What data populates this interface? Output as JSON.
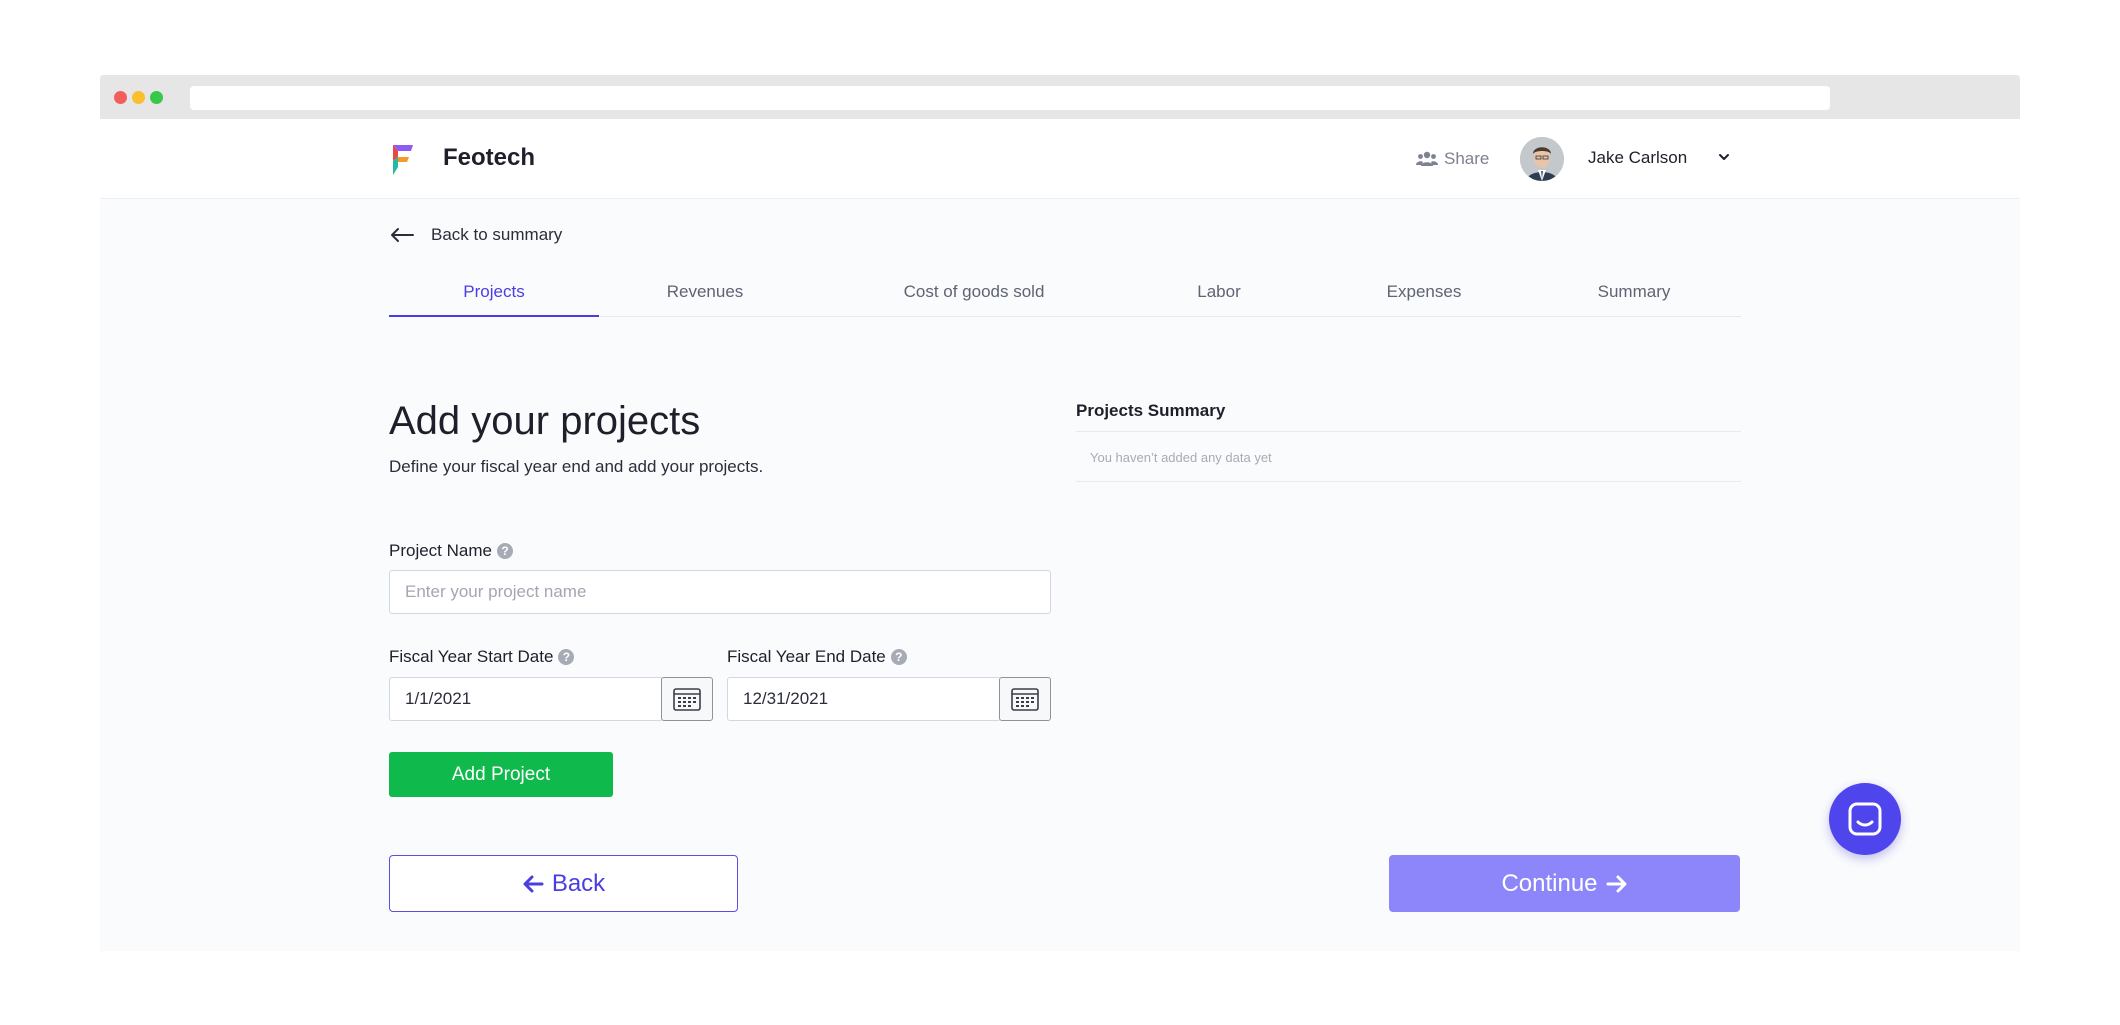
{
  "app": {
    "brand": "Feotech"
  },
  "header": {
    "share_label": "Share",
    "user_name": "Jake Carlson"
  },
  "nav": {
    "back_link": "Back to summary"
  },
  "tabs": [
    {
      "label": "Projects",
      "active": true
    },
    {
      "label": "Revenues",
      "active": false
    },
    {
      "label": "Cost of goods sold",
      "active": false
    },
    {
      "label": "Labor",
      "active": false
    },
    {
      "label": "Expenses",
      "active": false
    },
    {
      "label": "Summary",
      "active": false
    }
  ],
  "main": {
    "title": "Add your projects",
    "subtitle": "Define your fiscal year end and add your projects."
  },
  "form": {
    "project_name_label": "Project Name",
    "project_name_placeholder": "Enter your project name",
    "project_name_value": "",
    "start_date_label": "Fiscal Year Start Date",
    "start_date_value": "1/1/2021",
    "end_date_label": "Fiscal Year End Date",
    "end_date_value": "12/31/2021",
    "add_button": "Add Project",
    "help_glyph": "?"
  },
  "summary": {
    "title": "Projects Summary",
    "empty_text": "You haven’t added any data yet"
  },
  "footer": {
    "back_button": "Back",
    "continue_button": "Continue"
  },
  "colors": {
    "accent": "#4b3ee0",
    "add_button": "#10b94c",
    "continue_button": "#8d86fb",
    "chat_bubble": "#4e45ec"
  },
  "icons": [
    "logo-icon",
    "share-people-icon",
    "chevron-down-icon",
    "arrow-left-icon",
    "help-icon",
    "calendar-icon",
    "arrow-right-icon",
    "chat-icon"
  ]
}
